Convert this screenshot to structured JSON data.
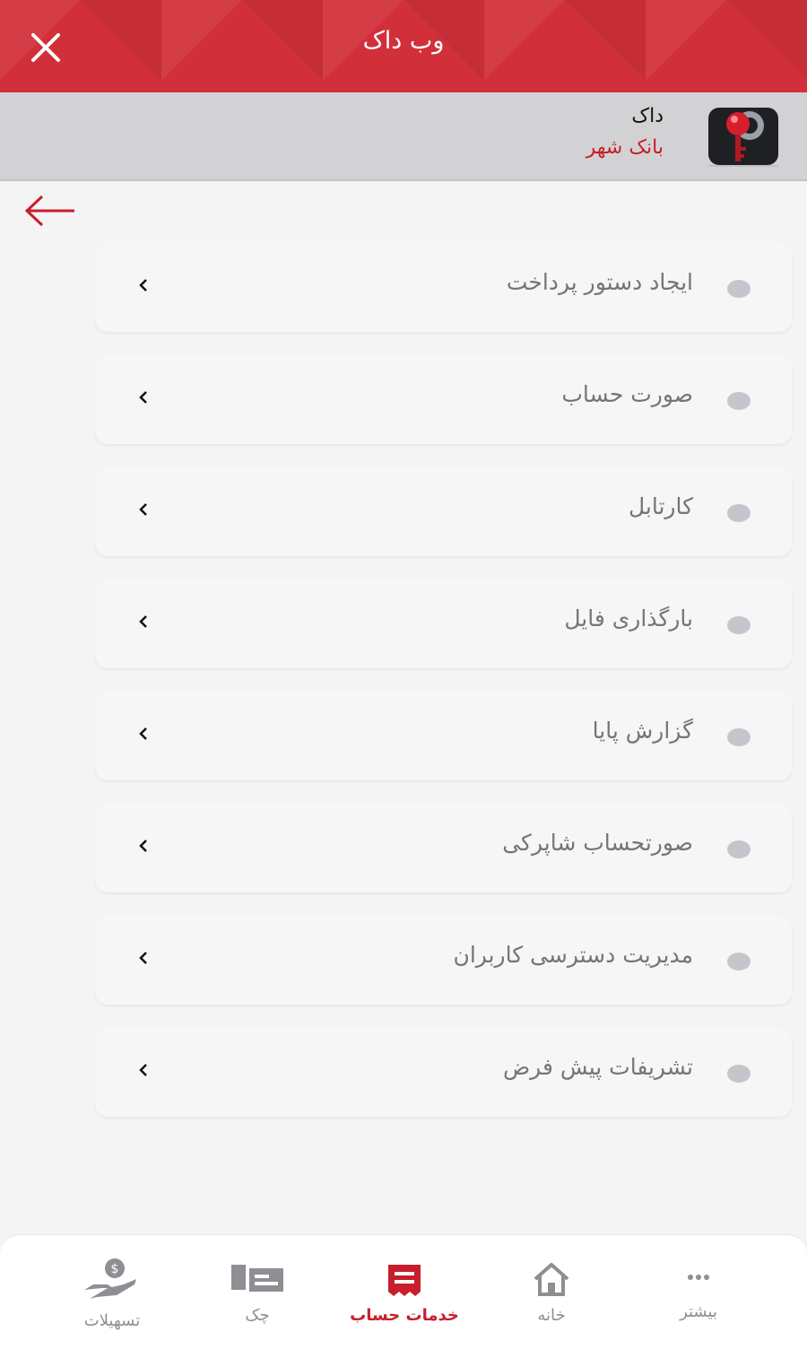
{
  "header": {
    "title": "وب داک"
  },
  "app": {
    "name": "داک",
    "bank": "بانک شهر"
  },
  "menu": [
    {
      "label": "ایجاد دستور پرداخت"
    },
    {
      "label": "صورت حساب"
    },
    {
      "label": "کارتابل"
    },
    {
      "label": "بارگذاری فایل"
    },
    {
      "label": "گزارش پایا"
    },
    {
      "label": "صورتحساب شاپرکی"
    },
    {
      "label": "مدیریت دسترسی کاربران"
    },
    {
      "label": "تشریفات پیش فرض"
    }
  ],
  "tabs": {
    "facilities": "تسهیلات",
    "check": "چک",
    "account_services": "خدمات حساب",
    "home": "خانه",
    "more": "بیشتر"
  },
  "colors": {
    "accent": "#c81e2b",
    "header": "#d1303a"
  },
  "icons": {
    "close": "close-icon",
    "back": "arrow-left-icon",
    "chevron": "chevron-left-icon"
  }
}
